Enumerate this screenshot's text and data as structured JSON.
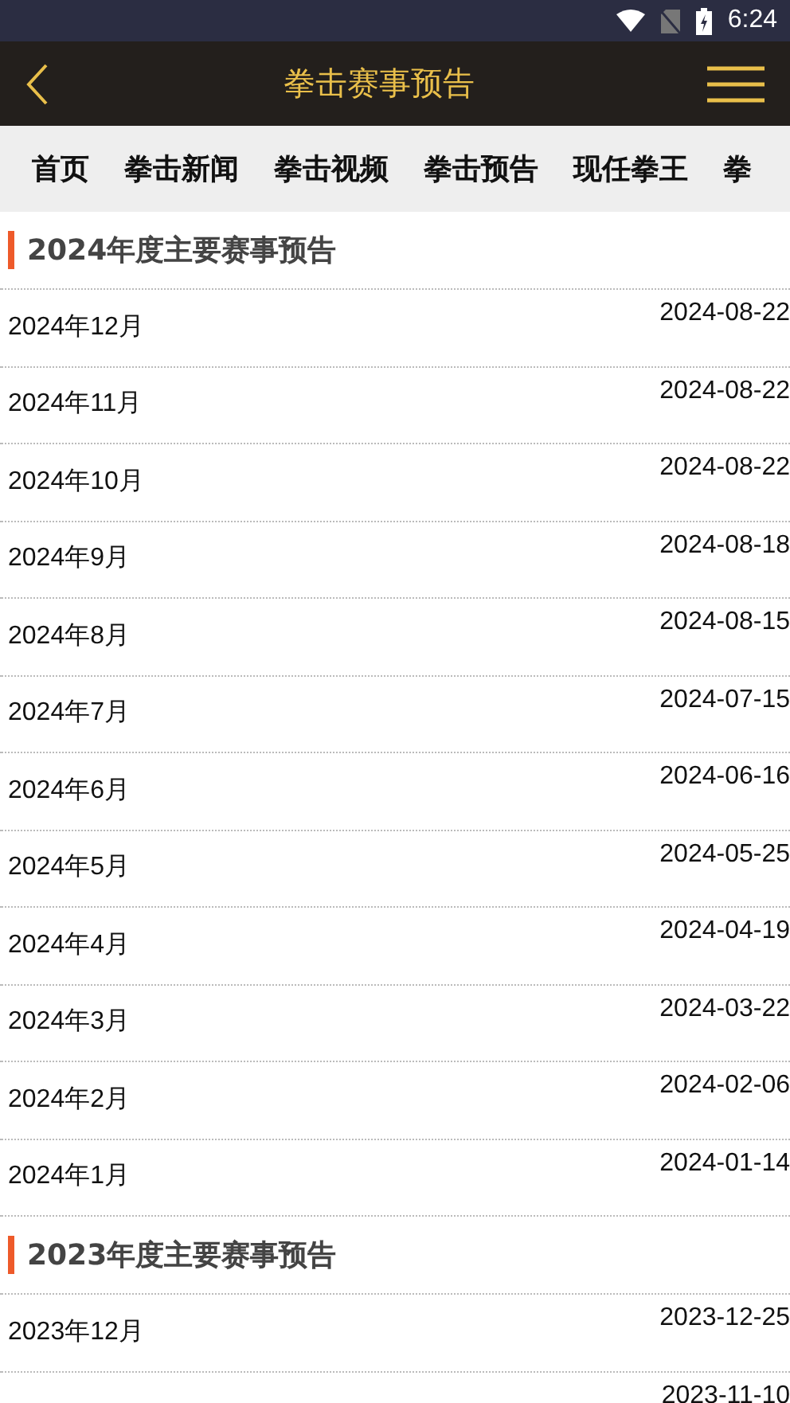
{
  "status_bar": {
    "time": "6:24"
  },
  "header": {
    "title": "拳击赛事预告"
  },
  "tabs": [
    {
      "label": "首页",
      "selected": false
    },
    {
      "label": "拳击新闻",
      "selected": false
    },
    {
      "label": "拳击视频",
      "selected": false
    },
    {
      "label": "拳击预告",
      "selected": false
    },
    {
      "label": "现任拳王",
      "selected": false
    },
    {
      "label": "拳",
      "selected": false
    }
  ],
  "sections": [
    {
      "title": "2024年度主要赛事预告",
      "rows": [
        {
          "name": "2024年12月",
          "date": "2024-08-22"
        },
        {
          "name": "2024年11月",
          "date": "2024-08-22"
        },
        {
          "name": "2024年10月",
          "date": "2024-08-22"
        },
        {
          "name": "2024年9月",
          "date": "2024-08-18"
        },
        {
          "name": "2024年8月",
          "date": "2024-08-15"
        },
        {
          "name": "2024年7月",
          "date": "2024-07-15"
        },
        {
          "name": "2024年6月",
          "date": "2024-06-16"
        },
        {
          "name": "2024年5月",
          "date": "2024-05-25"
        },
        {
          "name": "2024年4月",
          "date": "2024-04-19"
        },
        {
          "name": "2024年3月",
          "date": "2024-03-22"
        },
        {
          "name": "2024年2月",
          "date": "2024-02-06"
        },
        {
          "name": "2024年1月",
          "date": "2024-01-14"
        }
      ]
    },
    {
      "title": "2023年度主要赛事预告",
      "rows": [
        {
          "name": "2023年12月",
          "date": "2023-12-25"
        },
        {
          "date": "2023-11-10"
        }
      ]
    }
  ]
}
